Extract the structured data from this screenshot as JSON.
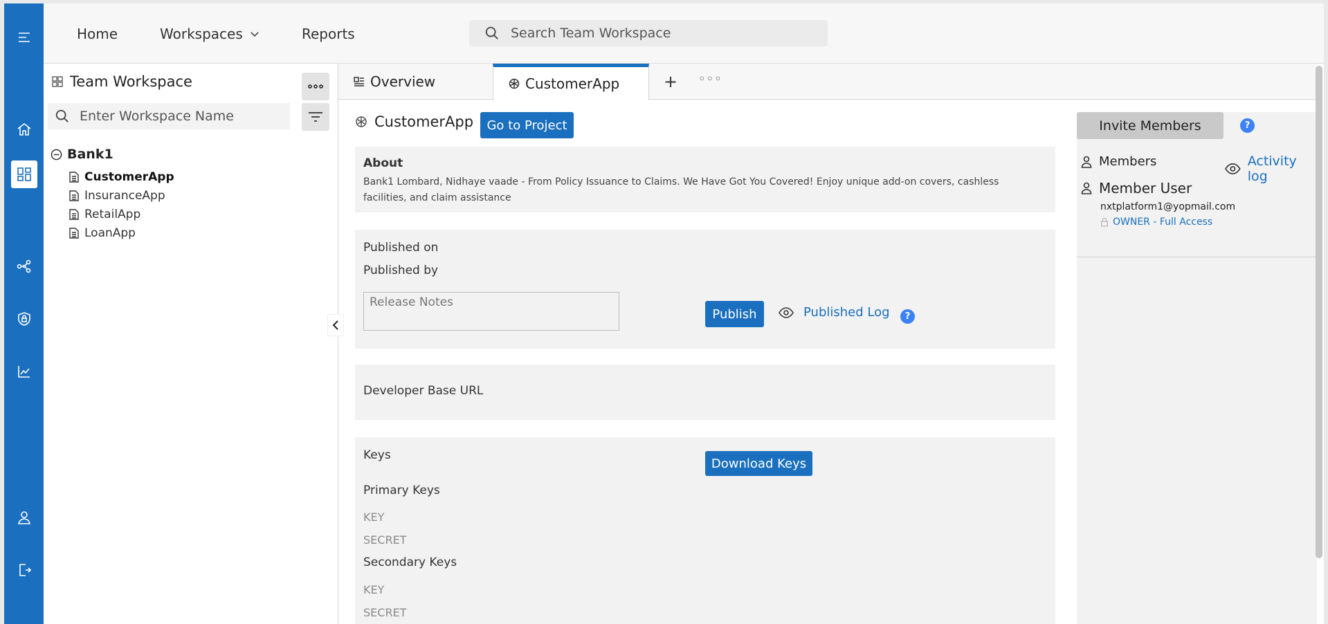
{
  "rail": {
    "icons": [
      "menu-icon",
      "home-icon",
      "workspace-icon",
      "share-nodes-icon",
      "shield-lock-icon",
      "chart-icon",
      "user-icon",
      "logout-icon"
    ]
  },
  "topnav": {
    "home": "Home",
    "workspaces": "Workspaces",
    "reports": "Reports",
    "search_placeholder": "Search Team Workspace"
  },
  "left": {
    "title": "Team Workspace",
    "search_placeholder": "Enter Workspace Name",
    "tree": {
      "root": "Bank1",
      "items": [
        "CustomerApp",
        "InsuranceApp",
        "RetailApp",
        "LoanApp"
      ],
      "selected": "CustomerApp"
    }
  },
  "tabs": {
    "overview": "Overview",
    "customerapp": "CustomerApp",
    "add": "+",
    "more": "◦◦◦"
  },
  "project": {
    "name": "CustomerApp",
    "go_button": "Go to Project",
    "about_heading": "About",
    "about_text": "Bank1 Lombard, Nidhaye vaade - From Policy Issuance to Claims. We Have Got You Covered! Enjoy unique add-on covers, cashless facilities, and claim assistance"
  },
  "publish": {
    "published_on": "Published on",
    "published_by": "Published by",
    "notes_placeholder": "Release Notes",
    "publish_button": "Publish",
    "log_link": "Published Log",
    "help": "?"
  },
  "developer": {
    "base_url_label": "Developer Base URL"
  },
  "keys": {
    "heading": "Keys",
    "download_button": "Download Keys",
    "primary": "Primary Keys",
    "primary_key": "KEY",
    "primary_secret": "SECRET",
    "secondary": "Secondary Keys",
    "secondary_key": "KEY",
    "secondary_secret": "SECRET"
  },
  "members": {
    "invite_button": "Invite Members",
    "help": "?",
    "members_label": "Members",
    "activity_log": "Activity log",
    "member_name": "Member User",
    "member_email": "nxtplatform1@yopmail.com",
    "member_role": "OWNER - Full Access"
  },
  "colors": {
    "brand": "#1a6fbe",
    "help": "#3b82f6",
    "card_bg": "#f2f2f2"
  }
}
